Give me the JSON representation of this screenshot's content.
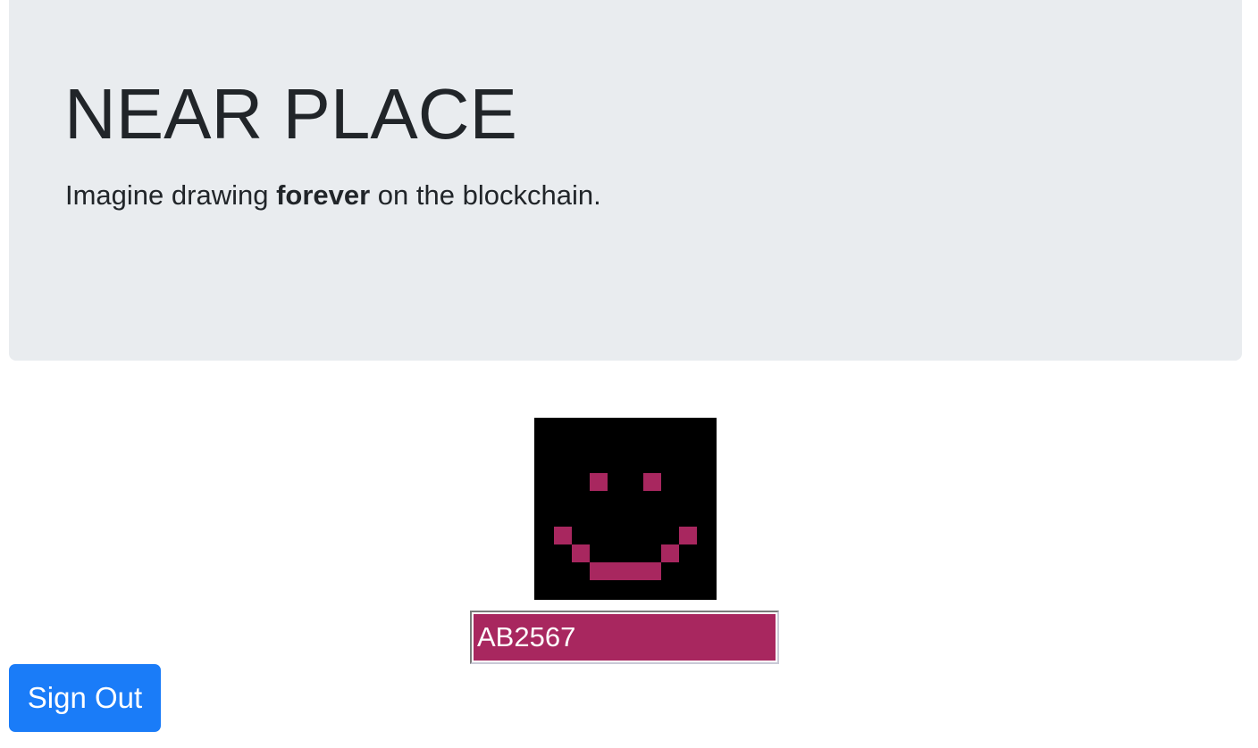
{
  "header": {
    "title": "NEAR PLACE",
    "lead_before": "Imagine drawing ",
    "lead_bold": "forever",
    "lead_after": " on the blockchain."
  },
  "board": {
    "background_color": "#000000",
    "pixel_color": "#a8275f",
    "grid_size": 10,
    "painted_pixels": [
      {
        "col": 3,
        "row": 3
      },
      {
        "col": 6,
        "row": 3
      },
      {
        "col": 1,
        "row": 6
      },
      {
        "col": 8,
        "row": 6
      },
      {
        "col": 2,
        "row": 7
      },
      {
        "col": 7,
        "row": 7
      },
      {
        "col": 3,
        "row": 8
      },
      {
        "col": 4,
        "row": 8
      },
      {
        "col": 5,
        "row": 8
      },
      {
        "col": 6,
        "row": 8
      }
    ]
  },
  "color_picker": {
    "value": "AB2567",
    "background_color": "#a8275f"
  },
  "actions": {
    "sign_out_label": "Sign Out",
    "button_color": "#1a7cf8"
  }
}
